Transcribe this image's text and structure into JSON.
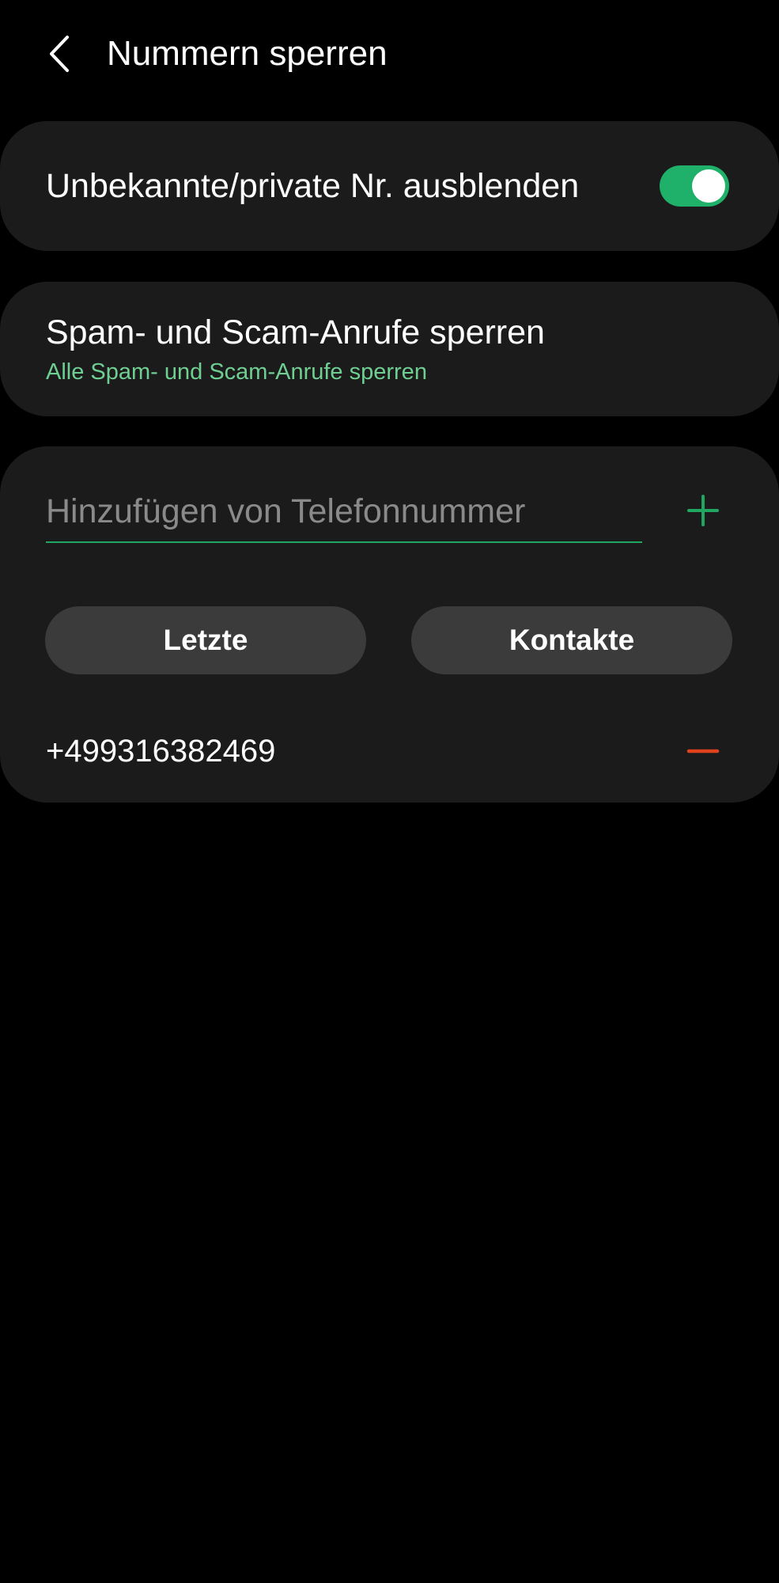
{
  "header": {
    "title": "Nummern sperren",
    "back_icon": "chevron-left-icon"
  },
  "settings": {
    "hide_unknown": {
      "label": "Unbekannte/private Nr. ausblenden",
      "enabled": true
    },
    "spam": {
      "title": "Spam- und Scam-Anrufe sperren",
      "subtitle": "Alle Spam- und Scam-Anrufe sperren"
    }
  },
  "block_list": {
    "input": {
      "value": "",
      "placeholder": "Hinzufügen von Telefonnummer"
    },
    "add_icon": "plus-icon",
    "buttons": {
      "recent": "Letzte",
      "contacts": "Kontakte"
    },
    "numbers": [
      "+499316382469"
    ],
    "remove_icon": "minus-icon"
  },
  "colors": {
    "accent": "#1fb069",
    "subtitle": "#6fcf93",
    "remove": "#e0421c",
    "card": "#1b1b1b",
    "button": "#3b3b3b"
  }
}
